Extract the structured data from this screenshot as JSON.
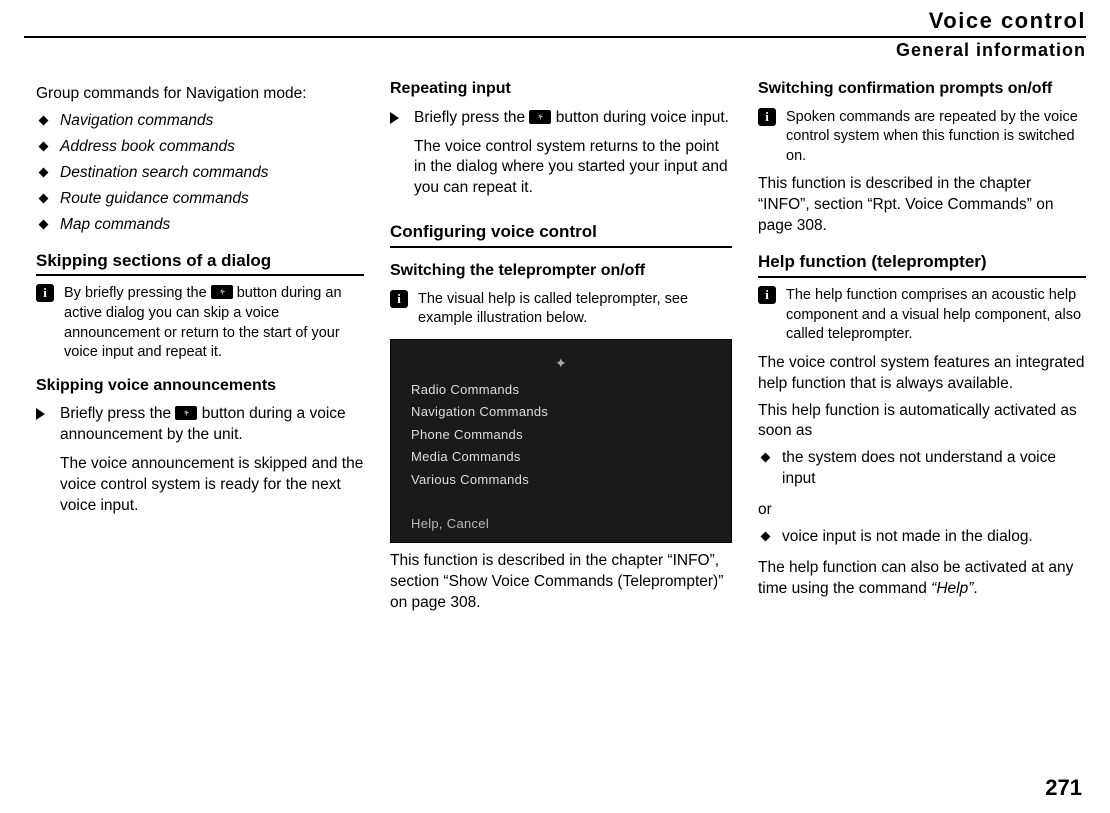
{
  "header": {
    "title": "Voice control",
    "subtitle": "General information"
  },
  "col1": {
    "intro": "Group commands for Navigation mode:",
    "navGroup": [
      "Navigation commands",
      "Address book commands",
      "Destination search commands",
      "Route guidance commands",
      "Map commands"
    ],
    "skipHeading": "Skipping sections of a dialog",
    "skipInfoPre": "By briefly pressing the ",
    "skipInfoPost": " button during an active dialog you can skip a voice announcement or return to the start of your voice input and repeat it.",
    "skipVoiceHeading": "Skipping voice announcements",
    "skipVoiceStepPre": "Briefly press the ",
    "skipVoiceStepPost": " button during a voice announcement by the unit.",
    "skipVoiceResult": "The voice announcement is skipped and the voice control system is ready for the next voice input."
  },
  "col2": {
    "repeatHeading": "Repeating input",
    "repeatStepPre": "Briefly press the ",
    "repeatStepPost": " button during voice input.",
    "repeatResult": "The voice control system returns to the point in the dialog where you started your input and you can repeat it.",
    "configHeading": "Configuring voice control",
    "teleHeading": "Switching the teleprompter on/off",
    "teleInfo": "The visual help is called teleprompter, see example illustration below.",
    "screenshot": {
      "items": [
        "Radio Commands",
        "Navigation Commands",
        "Phone Commands",
        "Media Commands",
        "Various Commands"
      ],
      "footer": "Help, Cancel"
    },
    "teleDesc": "This function is described in the chapter “INFO”, section “Show Voice Commands (Teleprompter)” on page 308."
  },
  "col3": {
    "confirmHeading": "Switching confirmation prompts on/off",
    "confirmInfo": "Spoken commands are repeated by the voice control system when this function is switched on.",
    "confirmDesc": "This function is described in the chapter “INFO”, section “Rpt. Voice Commands” on page 308.",
    "helpHeading": "Help function (teleprompter)",
    "helpInfo": "The help function comprises an acoustic help component and a visual help component, also called teleprompter.",
    "helpP1": "The voice control system features an integrated help function that is always available.",
    "helpP2": "This help function is automatically activated as soon as",
    "helpBullets1": "the system does not understand a voice input",
    "or": "or",
    "helpBullets2": "voice input is not made in the dialog.",
    "helpP3Pre": "The help function can also be activated at any time using the command ",
    "helpCmd": "“Help”",
    "helpP3Post": "."
  },
  "pageNum": "271"
}
